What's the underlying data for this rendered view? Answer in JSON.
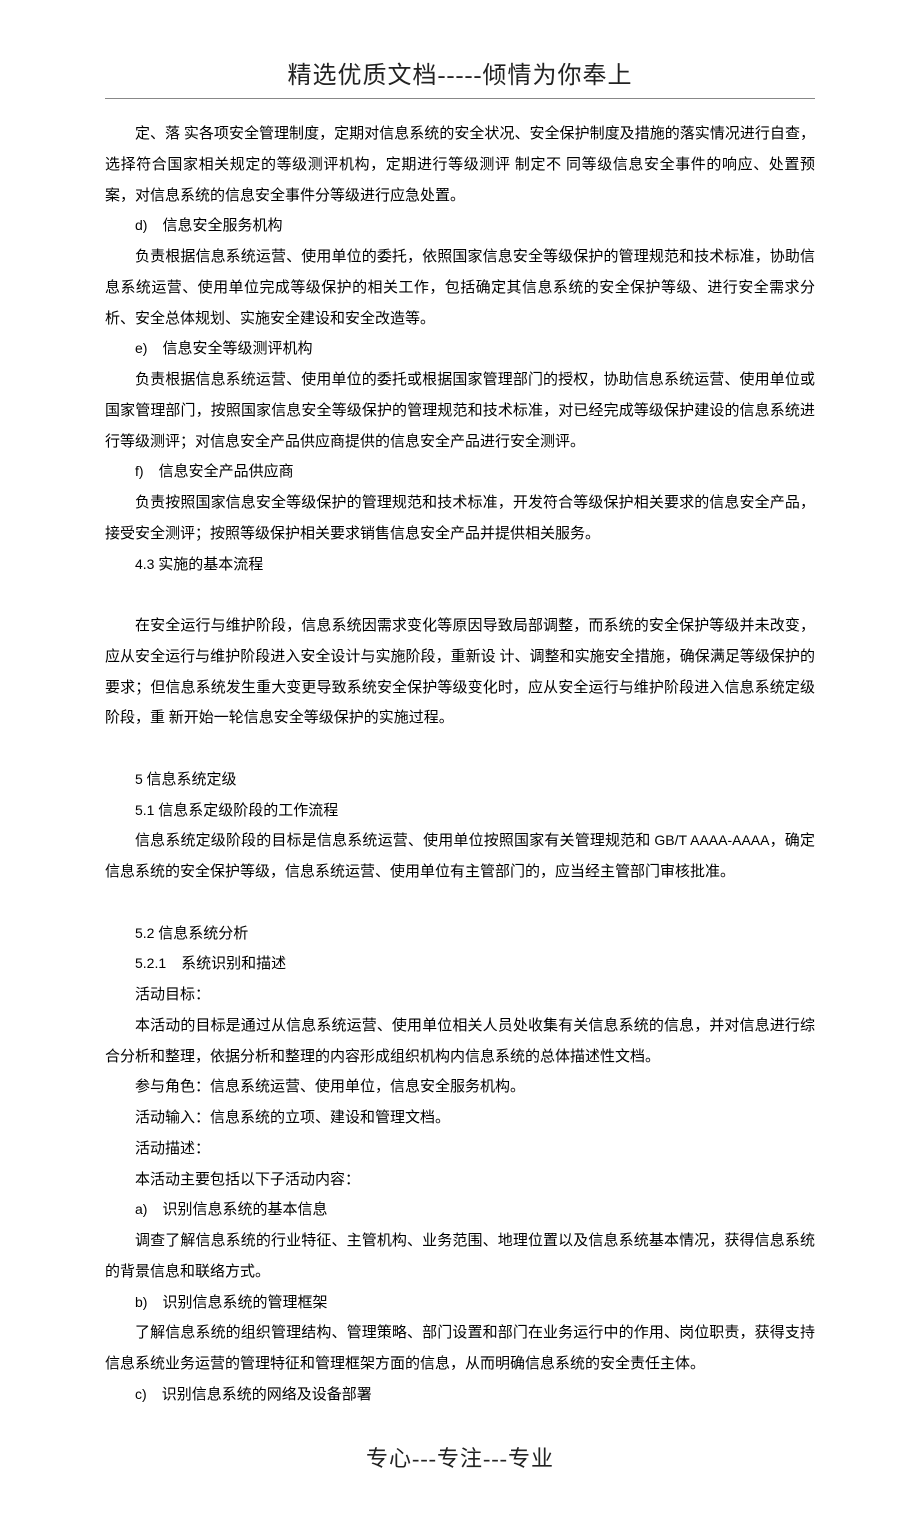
{
  "header": "精选优质文档-----倾情为你奉上",
  "footer": "专心---专注---专业",
  "paragraphs": [
    "定、落 实各项安全管理制度，定期对信息系统的安全状况、安全保护制度及措施的落实情况进行自查，选择符合国家相关规定的等级测评机构，定期进行等级测评 制定不 同等级信息安全事件的响应、处置预案，对信息系统的信息安全事件分等级进行应急处置。",
    "d)　信息安全服务机构",
    "负责根据信息系统运营、使用单位的委托，依照国家信息安全等级保护的管理规范和技术标准，协助信息系统运营、使用单位完成等级保护的相关工作，包括确定其信息系统的安全保护等级、进行安全需求分析、安全总体规划、实施安全建设和安全改造等。",
    "e)　信息安全等级测评机构",
    "负责根据信息系统运营、使用单位的委托或根据国家管理部门的授权，协助信息系统运营、使用单位或国家管理部门，按照国家信息安全等级保护的管理规范和技术标准，对已经完成等级保护建设的信息系统进行等级测评；对信息安全产品供应商提供的信息安全产品进行安全测评。",
    "f)　信息安全产品供应商",
    "负责按照国家信息安全等级保护的管理规范和技术标准，开发符合等级保护相关要求的信息安全产品，接受安全测评；按照等级保护相关要求销售信息安全产品并提供相关服务。",
    "4.3 实施的基本流程",
    "",
    "在安全运行与维护阶段，信息系统因需求变化等原因导致局部调整，而系统的安全保护等级并未改变，应从安全运行与维护阶段进入安全设计与实施阶段，重新设 计、调整和实施安全措施，确保满足等级保护的要求；但信息系统发生重大变更导致系统安全保护等级变化时，应从安全运行与维护阶段进入信息系统定级阶段，重 新开始一轮信息安全等级保护的实施过程。",
    "",
    "5 信息系统定级",
    "5.1 信息系定级阶段的工作流程",
    "信息系统定级阶段的目标是信息系统运营、使用单位按照国家有关管理规范和 GB/T AAAA-AAAA，确定信息系统的安全保护等级，信息系统运营、使用单位有主管部门的，应当经主管部门审核批准。",
    "",
    "5.2 信息系统分析",
    "5.2.1　系统识别和描述",
    "活动目标：",
    "本活动的目标是通过从信息系统运营、使用单位相关人员处收集有关信息系统的信息，并对信息进行综合分析和整理，依据分析和整理的内容形成组织机构内信息系统的总体描述性文档。",
    "参与角色：信息系统运营、使用单位，信息安全服务机构。",
    "活动输入：信息系统的立项、建设和管理文档。",
    "活动描述：",
    "本活动主要包括以下子活动内容：",
    "a)　识别信息系统的基本信息",
    "调查了解信息系统的行业特征、主管机构、业务范围、地理位置以及信息系统基本情况，获得信息系统的背景信息和联络方式。",
    "b)　识别信息系统的管理框架",
    "了解信息系统的组织管理结构、管理策略、部门设置和部门在业务运行中的作用、岗位职责，获得支持信息系统业务运营的管理特征和管理框架方面的信息，从而明确信息系统的安全责任主体。",
    "c)　识别信息系统的网络及设备部署"
  ]
}
